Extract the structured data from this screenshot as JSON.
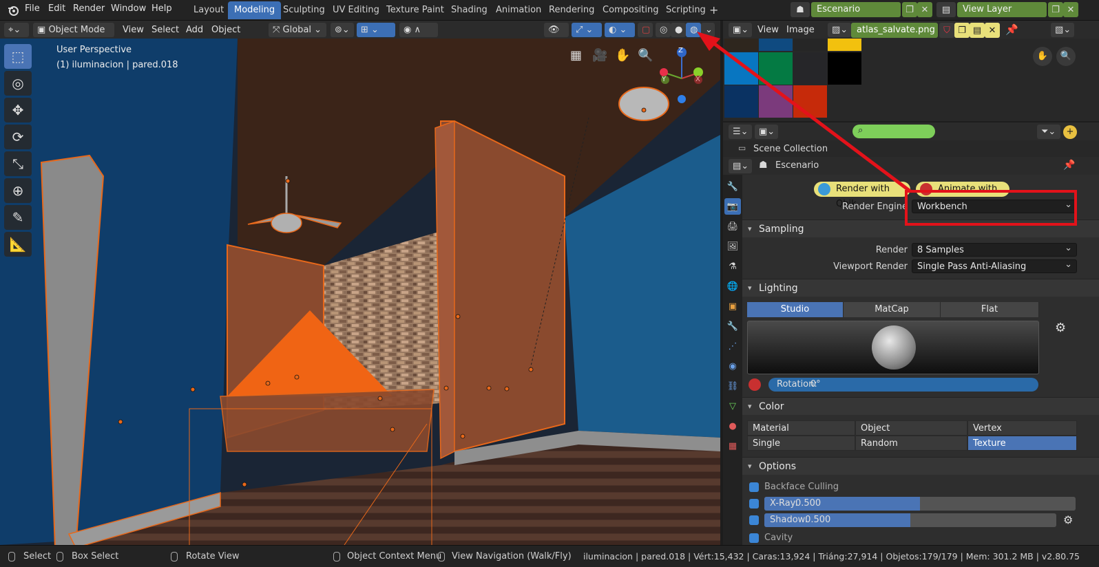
{
  "menu": [
    "File",
    "Edit",
    "Render",
    "Window",
    "Help"
  ],
  "workspaces": [
    {
      "label": "Layout",
      "active": false
    },
    {
      "label": "Modeling",
      "active": true
    },
    {
      "label": "Sculpting",
      "active": false
    },
    {
      "label": "UV Editing",
      "active": false
    },
    {
      "label": "Texture Paint",
      "active": false
    },
    {
      "label": "Shading",
      "active": false
    },
    {
      "label": "Animation",
      "active": false
    },
    {
      "label": "Rendering",
      "active": false
    },
    {
      "label": "Compositing",
      "active": false
    },
    {
      "label": "Scripting",
      "active": false
    }
  ],
  "add_workspace": "+",
  "scene_name": "Escenario",
  "view_layer": "View Layer",
  "viewport_header": {
    "mode": "Object Mode",
    "menus": [
      "View",
      "Select",
      "Add",
      "Object"
    ],
    "orientation": "Global"
  },
  "viewport": {
    "perspective": "User Perspective",
    "object_info": "(1) iluminacion | pared.018",
    "axis_z": "Z",
    "axis_x": "X",
    "axis_y": "Y"
  },
  "image_editor": {
    "menus": [
      "View",
      "Image"
    ],
    "image_name": "atlas_salvate.png",
    "swatch_colors": [
      "#2e261e",
      "#0f4a80",
      "#262626",
      "#f2c10e",
      "#0876c1",
      "#047a43",
      "#262629",
      "#000000",
      "#0a3262",
      "#7b3a7c",
      "#c62a0a"
    ]
  },
  "outliner": {
    "search_placeholder": "",
    "scene_collection": "Scene Collection"
  },
  "properties": {
    "context": "Escenario",
    "qbik_render": "Render with Qbik",
    "qbik_animate": "Animate with Qbik",
    "render_engine_label": "Render Engine",
    "render_engine": "Workbench",
    "sampling_title": "Sampling",
    "render_label": "Render",
    "render_value": "8 Samples",
    "viewport_render_label": "Viewport Render",
    "viewport_render_value": "Single Pass Anti-Aliasing",
    "lighting_title": "Lighting",
    "lighting_modes": [
      {
        "label": "Studio",
        "on": true
      },
      {
        "label": "MatCap",
        "on": false
      },
      {
        "label": "Flat",
        "on": false
      }
    ],
    "rotation_label": "Rotation:",
    "rotation_value": "0°",
    "color_title": "Color",
    "color_modes": [
      {
        "label": "Material",
        "on": false
      },
      {
        "label": "Object",
        "on": false
      },
      {
        "label": "Vertex",
        "on": false
      },
      {
        "label": "Single",
        "on": false
      },
      {
        "label": "Random",
        "on": false
      },
      {
        "label": "Texture",
        "on": true
      }
    ],
    "options_title": "Options",
    "backface_culling": "Backface Culling",
    "xray_label": "X-Ray:",
    "xray_value": "0.500",
    "xray_fraction": 0.5,
    "shadow_label": "Shadow:",
    "shadow_value": "0.500",
    "shadow_fraction": 0.5,
    "cavity": "Cavity"
  },
  "statusbar": {
    "select": "Select",
    "box_select": "Box Select",
    "rotate_view": "Rotate View",
    "context_menu": "Object Context Menu",
    "view_navigation": "View Navigation (Walk/Fly)",
    "stats": "iluminacion | pared.018 | Vért:15,432 | Caras:13,924 | Triáng:27,914 | Objetos:179/179 | Mem: 301.2 MB | v2.80.75"
  },
  "colors": {
    "accent_blue": "#4a74b5",
    "selection_orange": "#e8681a",
    "annotation_red": "#e3121a",
    "qbik_yellow": "#e8e07a"
  }
}
